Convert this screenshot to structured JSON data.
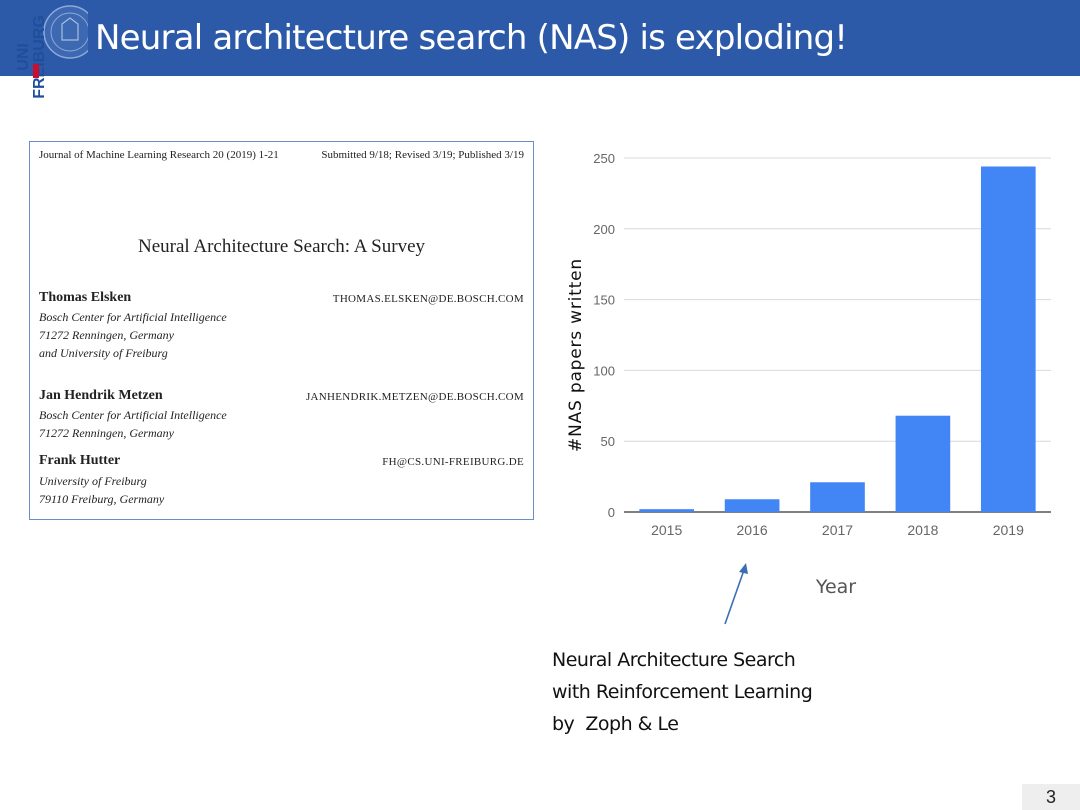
{
  "slide": {
    "title": "Neural architecture search (NAS) is exploding!",
    "page_number": "3",
    "logo": {
      "line1": "UNI",
      "line2": "FREIBURG"
    }
  },
  "paper": {
    "journal": "Journal of Machine Learning Research 20 (2019) 1-21",
    "submitted": "Submitted 9/18; Revised 3/19; Published 3/19",
    "title": "Neural Architecture Search: A Survey",
    "authors": [
      {
        "name": "Thomas Elsken",
        "email": "THOMAS.ELSKEN@DE.BOSCH.COM",
        "affiliation": [
          "Bosch Center for Artificial Intelligence",
          "71272 Renningen, Germany",
          "and University of Freiburg"
        ]
      },
      {
        "name": "Jan Hendrik Metzen",
        "email": "JANHENDRIK.METZEN@DE.BOSCH.COM",
        "affiliation": [
          "Bosch Center for Artificial Intelligence",
          "71272 Renningen, Germany"
        ]
      },
      {
        "name": "Frank Hutter",
        "email": "FH@CS.UNI-FREIBURG.DE",
        "affiliation": [
          "University of Freiburg",
          "79110 Freiburg, Germany"
        ]
      }
    ]
  },
  "chart_data": {
    "type": "bar",
    "categories": [
      "2015",
      "2016",
      "2017",
      "2018",
      "2019"
    ],
    "values": [
      2,
      9,
      21,
      68,
      244
    ],
    "xlabel": "Year",
    "ylabel": "#NAS papers written",
    "ylim": [
      0,
      250
    ],
    "yticks": [
      0,
      50,
      100,
      150,
      200,
      250
    ],
    "grid": true,
    "bar_color": "#4285f4"
  },
  "annotation": {
    "lines": [
      "Neural Architecture Search",
      "with Reinforcement Learning",
      "by  Zoph & Le"
    ],
    "arrow_color": "#3a6fb5"
  }
}
